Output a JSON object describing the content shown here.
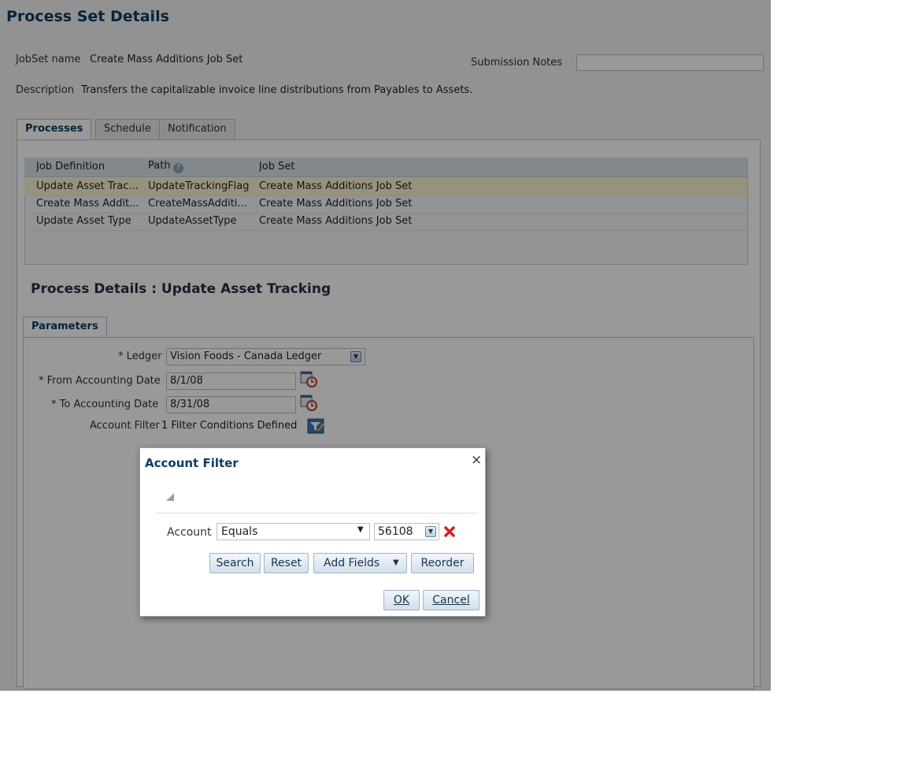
{
  "page_title": "Process Set Details",
  "jobset": {
    "label": "JobSet name",
    "value": "Create Mass Additions Job Set"
  },
  "submission_notes": {
    "label": "Submission Notes",
    "value": ""
  },
  "description": {
    "label": "Description",
    "value": "Transfers the capitalizable invoice line distributions from Payables to Assets."
  },
  "tabs": [
    {
      "label": "Processes",
      "active": true
    },
    {
      "label": "Schedule",
      "active": false
    },
    {
      "label": "Notification",
      "active": false
    }
  ],
  "table": {
    "headers": [
      "Job Definition",
      "Path",
      "Job Set"
    ],
    "rows": [
      [
        "Update Asset Trac...",
        "UpdateTrackingFlag",
        "Create Mass Additions Job Set"
      ],
      [
        "Create Mass Addit...",
        "CreateMassAdditi...",
        "Create Mass Additions Job Set"
      ],
      [
        "Update Asset Type",
        "UpdateAssetType",
        "Create Mass Additions Job Set"
      ]
    ],
    "selected_row": 0
  },
  "process_details_title": "Process Details : Update Asset Tracking",
  "params_tab": "Parameters",
  "params": {
    "ledger": {
      "label": "* Ledger",
      "value": "Vision Foods - Canada Ledger"
    },
    "from_date": {
      "label": "* From Accounting Date",
      "value": "8/1/08"
    },
    "to_date": {
      "label": "* To Accounting Date",
      "value": "8/31/08"
    },
    "account_filter": {
      "label": "Account Filter",
      "value": "1 Filter Conditions Defined"
    }
  },
  "dialog": {
    "title": "Account Filter",
    "close": "×",
    "account_label": "Account",
    "operator": "Equals",
    "account_value": "56108",
    "buttons": {
      "search": "Search",
      "reset": "Reset",
      "add_fields": "Add Fields",
      "reorder": "Reorder",
      "ok": "OK",
      "cancel": "Cancel"
    }
  },
  "icons": [
    "help-icon",
    "dropdown-icon",
    "calendar-icon",
    "filter-edit-icon",
    "close-icon",
    "remove-icon",
    "disclosure-icon"
  ],
  "colors": {
    "title": "#0d3c62",
    "selected_row": "#fbf3d0",
    "delete": "#d32020"
  }
}
